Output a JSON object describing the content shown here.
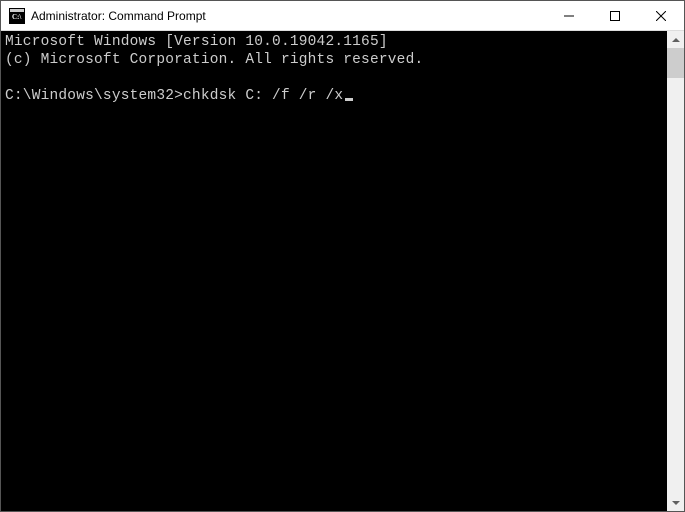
{
  "window": {
    "title": "Administrator: Command Prompt"
  },
  "terminal": {
    "line1": "Microsoft Windows [Version 10.0.19042.1165]",
    "line2": "(c) Microsoft Corporation. All rights reserved.",
    "blank": "",
    "prompt": "C:\\Windows\\system32>",
    "command": "chkdsk C: /f /r /x"
  }
}
